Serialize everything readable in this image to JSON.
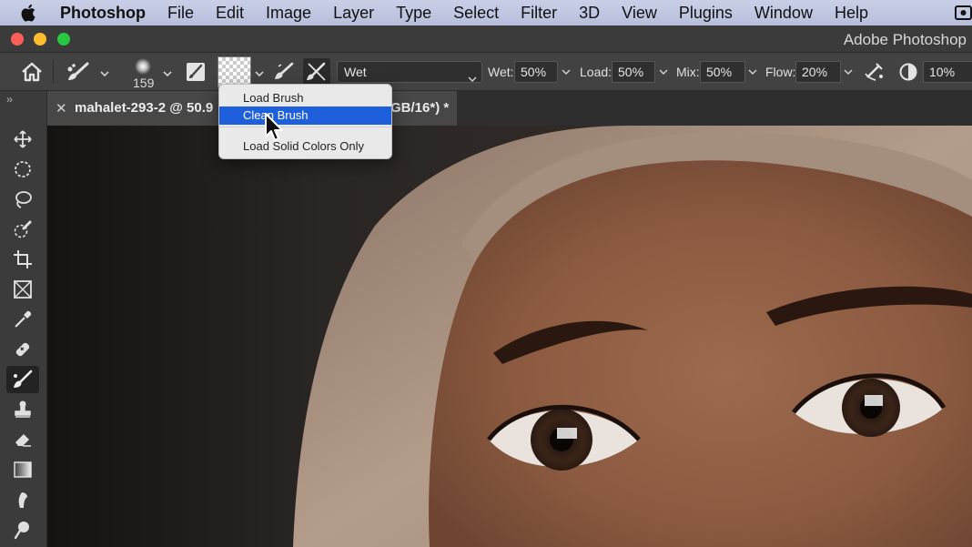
{
  "menubar": {
    "app_name": "Photoshop",
    "items": [
      "File",
      "Edit",
      "Image",
      "Layer",
      "Type",
      "Select",
      "Filter",
      "3D",
      "View",
      "Plugins",
      "Window",
      "Help"
    ]
  },
  "window": {
    "title": "Adobe Photoshop"
  },
  "options_bar": {
    "brush_size": "159",
    "preset": "Wet",
    "wet_label": "Wet:",
    "wet_value": "50%",
    "load_label": "Load:",
    "load_value": "50%",
    "mix_label": "Mix:",
    "mix_value": "50%",
    "flow_label": "Flow:",
    "flow_value": "20%",
    "angle_value": "10%"
  },
  "document_tab": {
    "title_visible": "mahalet-293-2 @ 50.9",
    "title_suffix": "GB/16*) *"
  },
  "dropdown": {
    "items": [
      "Load Brush",
      "Clean Brush",
      "Load Solid Colors Only"
    ],
    "highlighted": "Clean Brush"
  },
  "colors": {
    "menubar": "#bcc3df",
    "panel": "#424242",
    "selection": "#1e5fdc",
    "close": "#fe5f57",
    "minimize": "#febc2e",
    "maximize": "#28c840"
  },
  "toolbar_icons": [
    "move-tool-icon",
    "elliptical-marquee-icon",
    "lasso-icon",
    "quick-selection-icon",
    "crop-icon",
    "frame-icon",
    "eyedropper-icon",
    "healing-brush-icon",
    "mixer-brush-icon",
    "clone-stamp-icon",
    "eraser-icon",
    "gradient-icon",
    "smudge-icon",
    "dodge-icon"
  ]
}
